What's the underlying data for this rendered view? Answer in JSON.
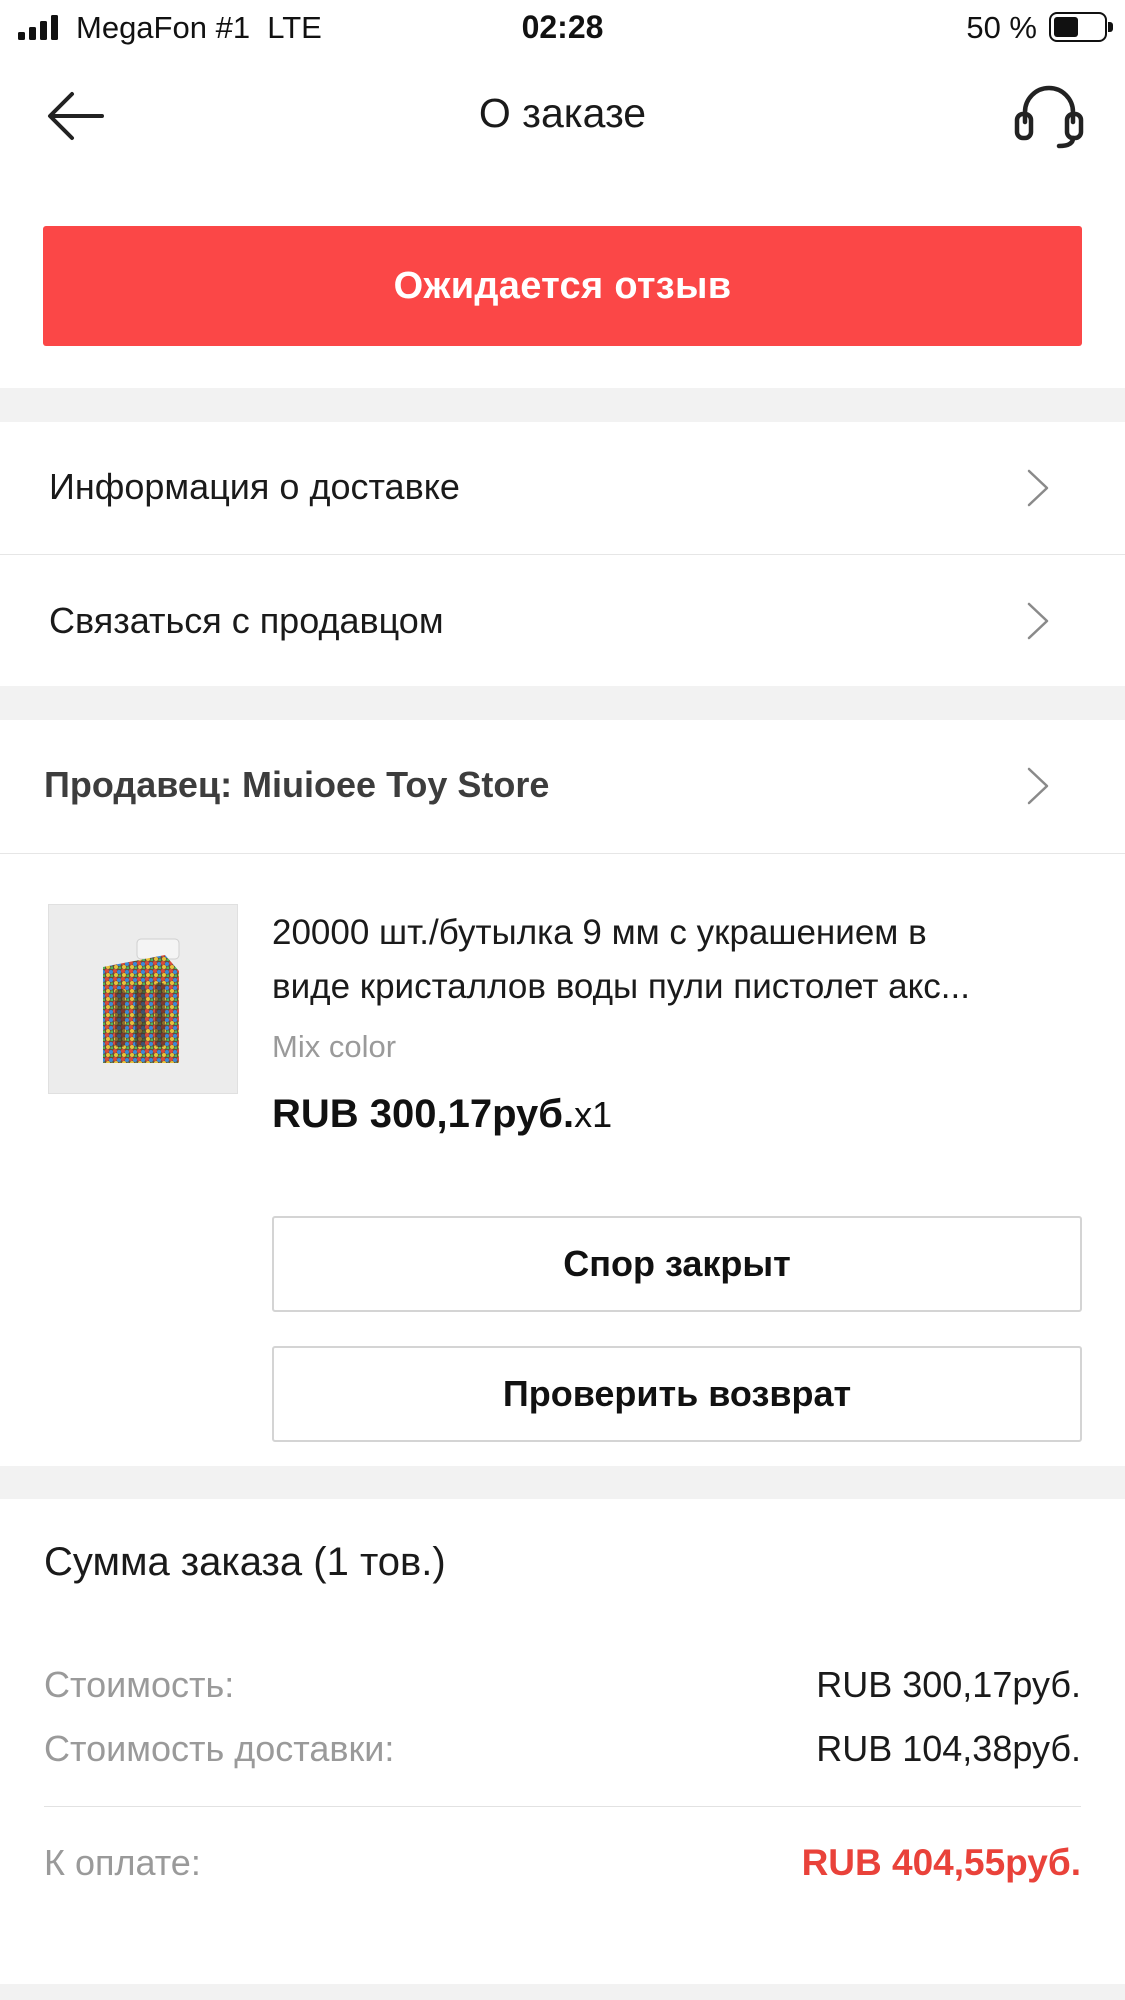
{
  "status_bar": {
    "carrier": "MegaFon #1",
    "network": "LTE",
    "time": "02:28",
    "battery": "50 %"
  },
  "nav": {
    "title": "О заказе"
  },
  "order_status": "Ожидается отзыв",
  "menu": {
    "delivery_info": "Информация о доставке",
    "contact_seller": "Связаться с продавцом"
  },
  "seller": {
    "label": "Продавец: Miuioee Toy Store"
  },
  "product": {
    "title_line1": "20000 шт./бутылка 9 мм с украшением в",
    "title_line2": "виде кристаллов воды пули пистолет акс...",
    "variant": "Mix color",
    "price": "RUB 300,17руб.",
    "quantity": "x1"
  },
  "actions": {
    "dispute_closed": "Спор закрыт",
    "check_return": "Проверить возврат"
  },
  "summary": {
    "title": "Сумма заказа (1 тов.)",
    "cost_label": "Стоимость:",
    "cost_value": "RUB 300,17руб.",
    "shipping_label": "Стоимость доставки:",
    "shipping_value": "RUB 104,38руб.",
    "total_label": "К оплате:",
    "total_value": "RUB 404,55руб."
  },
  "colors": {
    "accent_red": "#fb4747",
    "total_red": "#e9423a",
    "muted_text": "#9a9a9a",
    "section_gap": "#f2f2f2"
  }
}
